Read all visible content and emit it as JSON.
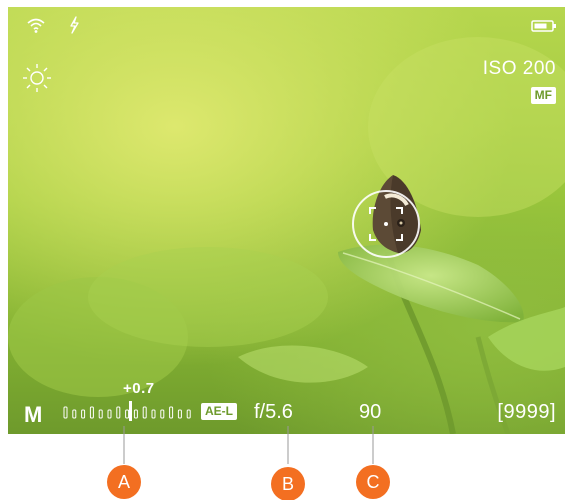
{
  "status_bar": {
    "wifi_icon": "wifi-icon",
    "flash_icon": "flash-icon",
    "battery_icon": "battery-icon"
  },
  "top_left": {
    "white_balance_icon": "sun-icon"
  },
  "top_right": {
    "iso": "ISO 200",
    "focus_mode": "MF"
  },
  "bottom_bar": {
    "mode": "M",
    "exposure_compensation": "+0.7",
    "ae_lock": "AE-L",
    "aperture": "f/5.6",
    "shutter": "90",
    "shots_remaining": "[9999]"
  },
  "callouts": [
    {
      "label": "A"
    },
    {
      "label": "B"
    },
    {
      "label": "C"
    }
  ],
  "colors": {
    "callout": "#f36f21",
    "overlay_text": "#ffffff"
  }
}
